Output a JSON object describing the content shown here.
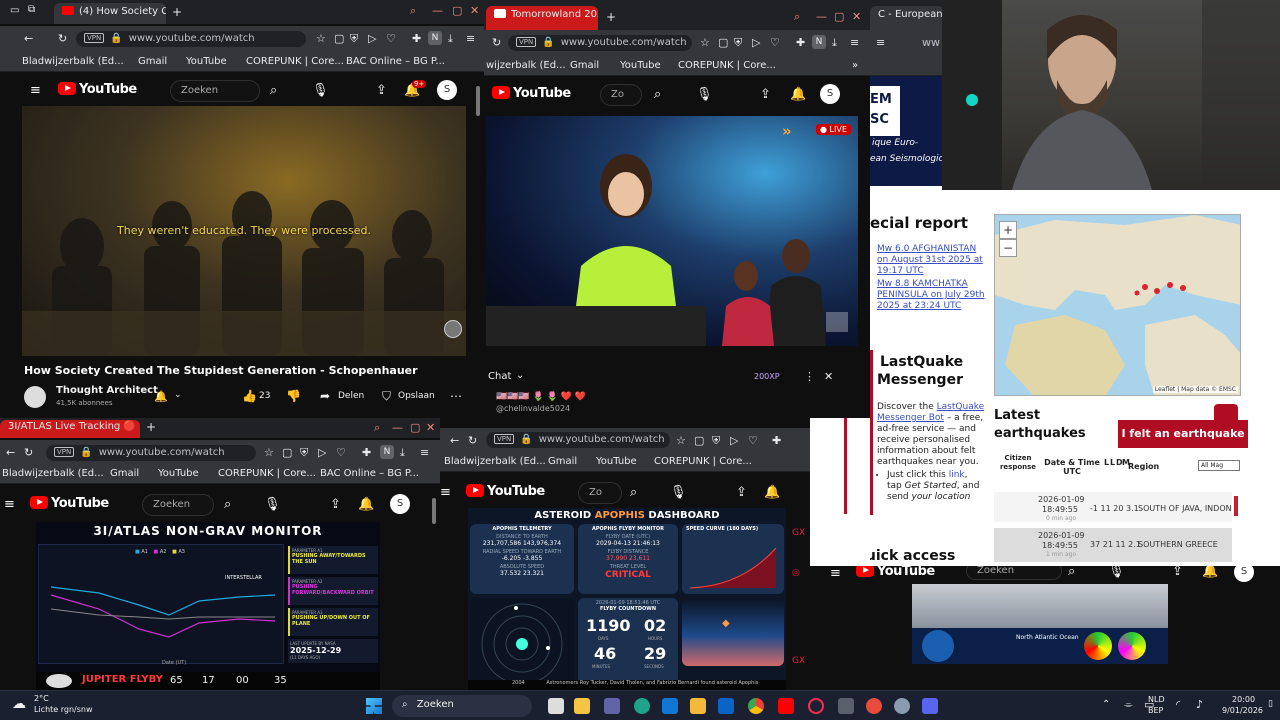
{
  "w1": {
    "tab": "(4) How Society Create",
    "url": "www.youtube.com/watch",
    "vpn": "VPN",
    "bm": [
      "Bladwijzerbalk (Ed...",
      "Gmail",
      "YouTube",
      "COREPUNK | Core...",
      "BAC Online – BG P..."
    ],
    "search": "Zoeken",
    "yt_region": "BE",
    "notif": "9+",
    "avatar": "S",
    "subtitle": "They weren't educated. They were processed.",
    "title": "How Society Created The Stupidest Generation - Schopenhauer",
    "channel": "Thought Architect",
    "subs": "41,5K abonnees",
    "likes": "23",
    "share": "Delen",
    "save": "Opslaan"
  },
  "w2": {
    "tab": "Tomorrowland 2026 🎧",
    "url": "www.youtube.com/watch",
    "bm": [
      "wijzerbalk (Ed...",
      "Gmail",
      "YouTube",
      "COREPUNK | Core..."
    ],
    "search": "Zo",
    "live": "LIVE",
    "chat": "Chat",
    "points": "200XP",
    "chat_user": "@chelinvalde5024",
    "chat_line": "🇺🇸🇺🇸🇺🇸 🌷 🌷 ❤️ ❤️"
  },
  "w3": {
    "tab": "C - European-Med",
    "url": "ww"
  },
  "emsc": {
    "logo_a": "EM",
    "logo_b": "SC",
    "euro": "ique Euro-",
    "seis": "ean Seismological",
    "special": "ecial report",
    "links": [
      "Mw 6.0 AFGHANISTAN on August 31st 2025 at 19:17 UTC",
      "Mw 8.8 KAMCHATKA PENINSULA on July 29th 2025 at 23:24 UTC"
    ],
    "lq1": "LastQuake",
    "lq2": "Messenger",
    "disc1": "Discover the",
    "disc_link": "LastQuake Messenger Bot",
    "disc2": " – a free, ad-free service — and receive personalised information about felt earthquakes near you.",
    "bullet1": "Just click this ",
    "bullet_link": "link",
    "bullet2": ", tap ",
    "bullet_em1": "Get Started",
    "bullet3": ", and send ",
    "bullet_em2": "your location",
    "map_attr": "Leaflet | Map data © EMSC",
    "latest1": "Latest",
    "latest2": "earthquakes",
    "felt": "I felt an earthquake",
    "cols": [
      "Citizen response",
      "Date & Time UTC",
      "L",
      "L",
      "D",
      "M",
      "Region"
    ],
    "filter": "All Mag",
    "rows": [
      {
        "date": "2026-01-09",
        "time": "18:49:55",
        "ago": "0 min ago",
        "vals": "-1 11 20 3.1",
        "region": "SOUTH OF JAVA, INDON..."
      },
      {
        "date": "2026-01-09",
        "time": "18:49:55",
        "ago": "1 min ago",
        "vals": "37 21 11 2.1",
        "region": "SOUTHERN GREECE"
      }
    ],
    "quick": "Quick access"
  },
  "w4": {
    "tab": "3I/ATLAS Live Tracking 🔴",
    "url": "www.youtube.com/watch",
    "bm": [
      "Bladwijzerbalk (Ed...",
      "Gmail",
      "YouTube",
      "COREPUNK | Core...",
      "BAC Online – BG P..."
    ],
    "search": "Zoeken",
    "avatar": "S",
    "monitor_title": "3I/ATLAS NON-GRAV MONITOR",
    "legend": [
      "A1",
      "A2",
      "A3"
    ],
    "params": [
      {
        "h": "PARAMETER A1",
        "v": "PUSHING AWAY/TOWARDS THE SUN"
      },
      {
        "h": "PARAMETER A2",
        "v": "PUSHING FORWARD/BACKWARD ORBIT"
      },
      {
        "h": "PARAMETER A3",
        "v": "PUSHING UP/DOWN OUT OF PLANE"
      }
    ],
    "update_h": "LAST UPDATE BY NASA",
    "update": "2025-12-29",
    "ago": "(11 DAYS AGO)",
    "date_label": "Date (UT)",
    "ticker": "JUPITER FLYBY",
    "ticker_nums": [
      "65",
      "17",
      "00",
      "35"
    ]
  },
  "w5": {
    "url": "www.youtube.com/watch",
    "bm": [
      "Bladwijzerbalk (Ed...",
      "Gmail",
      "YouTube",
      "COREPUNK | Core..."
    ],
    "search": "Zo",
    "dash_a": "ASTEROID ",
    "dash_b": "APOPHIS",
    "dash_c": " DASHBOARD",
    "tele": "APOPHIS TELEMETRY",
    "dist_h": "DISTANCE TO EARTH",
    "dist": "231,707,586",
    "dist2": "143,976,374",
    "rad_h": "RADIAL SPEED TOWARD EARTH",
    "rad": "-6.205",
    "rad2": "-3.855",
    "abs_h": "ABSOLUTE SPEED",
    "abs": "37.532",
    "abs2": "23.321",
    "flyby_h": "APOPHIS FLYBY MONITOR",
    "flyby_date_h": "FLYBY DATE (UTC)",
    "flyby_date": "2029-04-13",
    "flyby_time": "21:46:13",
    "fdist_h": "FLYBY DISTANCE",
    "fdist": "37,990",
    "fdist2": "23,611",
    "threat_h": "THREAT LEVEL",
    "threat": "CRITICAL",
    "curve_h": "SPEED CURVE (180 DAYS)",
    "clock": "2026-01-09 18:51:46 UTC",
    "count_h": "FLYBY COUNTDOWN",
    "days": "1190",
    "hours": "02",
    "mins": "46",
    "secs": "29",
    "dl": "DAYS",
    "hl": "HOURS",
    "ml": "MINUTES",
    "sl": "SECONDS",
    "ticker": "Astronomers Roy Tucker, David Tholen, and Fabrizio Bernardi found asteroid Apophis",
    "year": "2004"
  },
  "w6": {
    "search": "Zoeken",
    "ocean": "North Atlantic Ocean"
  },
  "taskbar": {
    "temp": "2°C",
    "weather": "Lichte rgn/snw",
    "search": "Zoeken",
    "lang1": "NLD",
    "lang2": "BEP",
    "time": "20:00",
    "date": "9/01/2026"
  }
}
